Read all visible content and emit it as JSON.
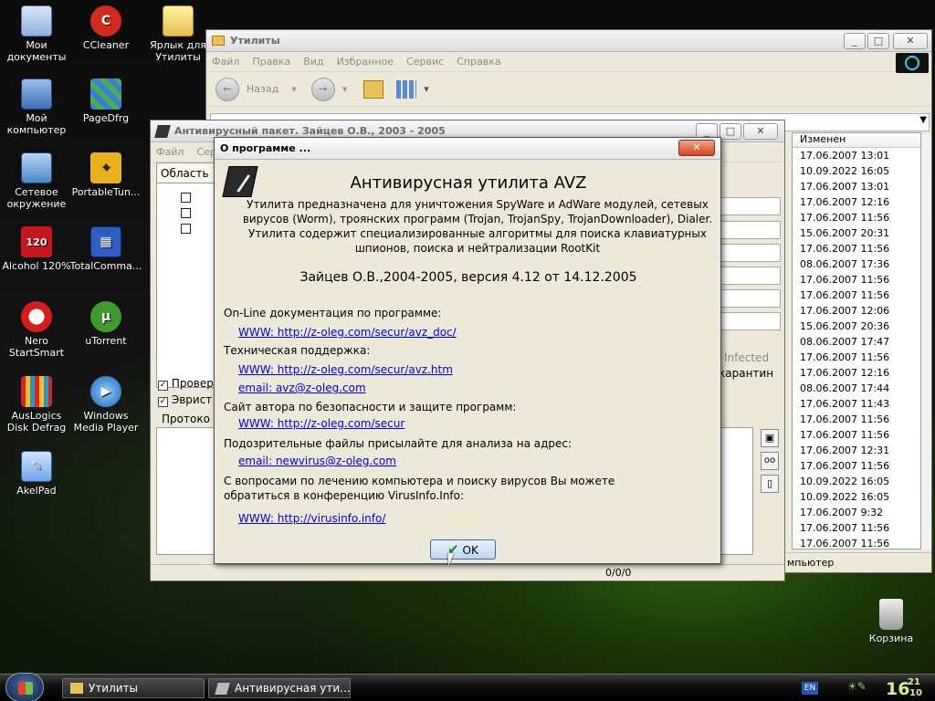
{
  "desktop": {
    "icons": [
      {
        "label": "Мои документы",
        "icon": "folder-docs-icon"
      },
      {
        "label": "CCleaner",
        "icon": "ccleaner-icon"
      },
      {
        "label": "Ярлык для Утилиты",
        "icon": "folder-shortcut-icon"
      },
      {
        "label": "Мой компьютер",
        "icon": "computer-icon"
      },
      {
        "label": "PageDfrg",
        "icon": "pagedfrg-icon"
      },
      {
        "label": "Сетевое окружение",
        "icon": "network-icon"
      },
      {
        "label": "PortableTun...",
        "icon": "portable-tuner-icon"
      },
      {
        "label": "Alcohol 120%",
        "icon": "alcohol-icon"
      },
      {
        "label": "TotalComma...",
        "icon": "total-commander-icon"
      },
      {
        "label": "Nero StartSmart",
        "icon": "nero-icon"
      },
      {
        "label": "uTorrent",
        "icon": "utorrent-icon"
      },
      {
        "label": "AusLogics Disk Defrag",
        "icon": "defrag-icon"
      },
      {
        "label": "Windows Media Player",
        "icon": "media-player-icon"
      },
      {
        "label": "AkelPad",
        "icon": "akelpad-icon"
      },
      {
        "label": "Корзина",
        "icon": "recycle-bin-icon"
      }
    ]
  },
  "explorer": {
    "title": "Утилиты",
    "menu": [
      "Файл",
      "Правка",
      "Вид",
      "Избранное",
      "Сервис",
      "Справка"
    ],
    "back_label": "Назад",
    "column_header": "Изменен",
    "dates": [
      "17.06.2007 13:01",
      "10.09.2022 16:05",
      "17.06.2007 13:01",
      "17.06.2007 12:16",
      "17.06.2007 11:56",
      "15.06.2007 20:31",
      "17.06.2007 11:56",
      "08.06.2007 17:36",
      "17.06.2007 11:56",
      "17.06.2007 11:56",
      "17.06.2007 12:06",
      "15.06.2007 20:36",
      "08.06.2007 17:47",
      "17.06.2007 11:56",
      "17.06.2007 12:16",
      "08.06.2007 17:44",
      "17.06.2007 11:43",
      "17.06.2007 11:56",
      "17.06.2007 11:56",
      "17.06.2007 12:31",
      "17.06.2007 11:56",
      "10.09.2022 16:05",
      "10.09.2022 16:05",
      "17.06.2007 9:32",
      "17.06.2007 11:56",
      "17.06.2007 11:56"
    ],
    "status_tail": "мпьютер"
  },
  "avz": {
    "title": "Антивирусный пакет. Зайцев О.В., 2003 - 2005",
    "menu": [
      "Файл",
      "Серв"
    ],
    "area_label": "Область",
    "check1": "Провер",
    "check2": "Эврист",
    "log_label": "Протоко",
    "infected_label": "Infected",
    "quarantine_label": "карантин",
    "status_value": "0/0/0"
  },
  "about": {
    "title": "О программе ...",
    "heading": "Антивирусная утилита AVZ",
    "description": "Утилита предназначена для уничтожения SpyWare и AdWare модулей, сетевых вирусов (Worm), троянских программ (Trojan, TrojanSpy, TrojanDownloader), Dialer. Утилита содержит специализированные алгоритмы для поиска клавиатурных шпионов, поиска и нейтрализации RootKit",
    "version": "Зайцев О.В.,2004-2005, версия 4.12 от 14.12.2005",
    "online_doc_label": "On-Line документация по программе:",
    "online_doc_link": "WWW: http://z-oleg.com/secur/avz_doc/",
    "support_label": "Техническая поддержка:",
    "support_link": "WWW: http://z-oleg.com/secur/avz.htm",
    "support_email": "email: avz@z-oleg.com",
    "author_site_label": "Сайт автора по безопасности и защите программ:",
    "author_site_link": "WWW: http://z-oleg.com/secur",
    "suspicious_label": "Подозрительные файлы присылайте для анализа на адрес:",
    "suspicious_email": "email: newvirus@z-oleg.com",
    "forum_text": "С вопросами по лечению компьютера и поиску вирусов Вы можете обратиться в конференцию VirusInfo.Info:",
    "forum_link": "WWW: http://virusinfo.info/",
    "ok_label": "OK"
  },
  "taskbar": {
    "items": [
      "Утилиты",
      "Антивирусная ути..."
    ],
    "language": "EN",
    "clock_hour": "16",
    "clock_min": "21",
    "clock_sec": "10"
  }
}
